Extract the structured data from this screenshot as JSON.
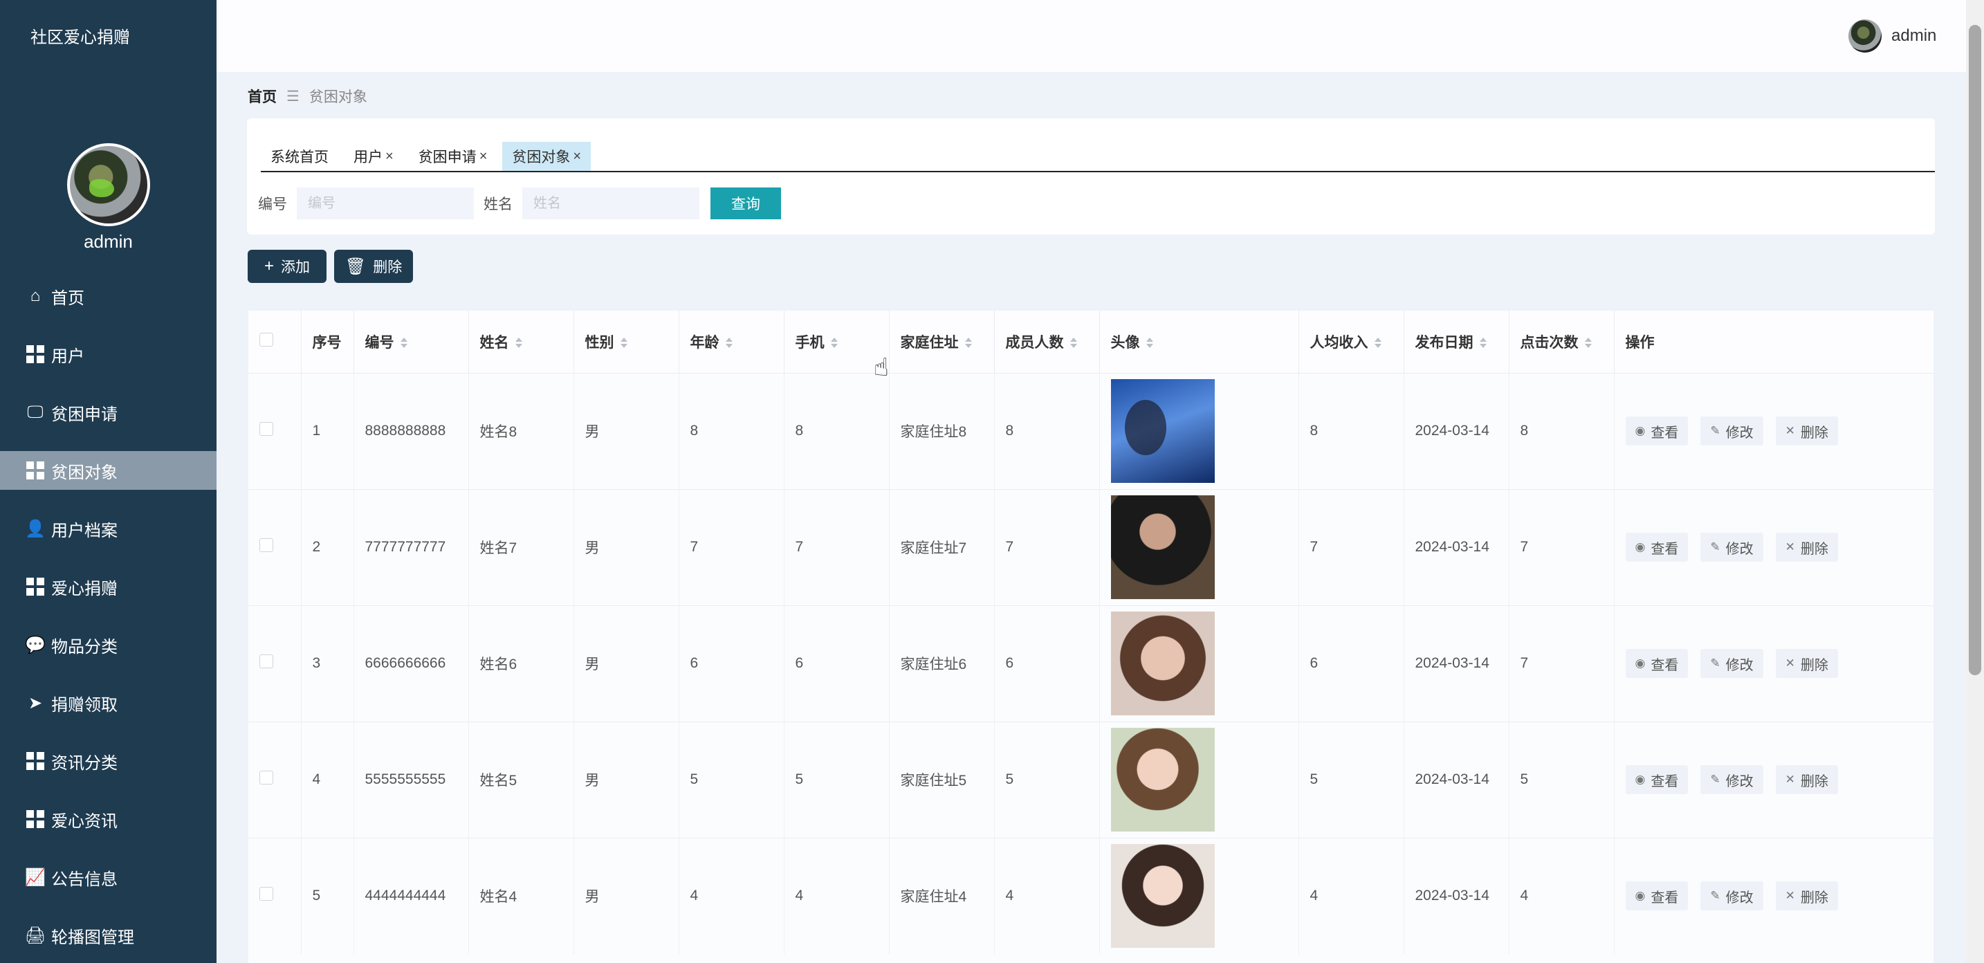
{
  "sidebar": {
    "app_title": "社区爱心捐赠",
    "username": "admin",
    "items": [
      {
        "label": "首页",
        "icon": "home-icon"
      },
      {
        "label": "用户",
        "icon": "grid-icon"
      },
      {
        "label": "贫困申请",
        "icon": "monitor-icon"
      },
      {
        "label": "贫困对象",
        "icon": "grid-icon",
        "active": true
      },
      {
        "label": "用户档案",
        "icon": "user-icon"
      },
      {
        "label": "爱心捐赠",
        "icon": "grid-icon"
      },
      {
        "label": "物品分类",
        "icon": "comment-icon"
      },
      {
        "label": "捐赠领取",
        "icon": "send-icon"
      },
      {
        "label": "资讯分类",
        "icon": "grid-icon"
      },
      {
        "label": "爱心资讯",
        "icon": "grid-icon"
      },
      {
        "label": "公告信息",
        "icon": "chart-icon"
      },
      {
        "label": "轮播图管理",
        "icon": "printer-icon"
      }
    ]
  },
  "topbar": {
    "username": "admin"
  },
  "breadcrumb": {
    "home": "首页",
    "separator": "☰",
    "current": "贫困对象"
  },
  "tabs": [
    {
      "label": "系统首页",
      "closable": false
    },
    {
      "label": "用户",
      "closable": true
    },
    {
      "label": "贫困申请",
      "closable": true
    },
    {
      "label": "贫困对象",
      "closable": true,
      "active": true
    }
  ],
  "tab_close_glyph": "×",
  "search": {
    "field1_label": "编号",
    "field1_placeholder": "编号",
    "field2_label": "姓名",
    "field2_placeholder": "姓名",
    "query_label": "查询",
    "query_color": "#19a2ad"
  },
  "actions": {
    "add_label": "添加",
    "delete_label": "删除"
  },
  "table": {
    "headers": [
      "序号",
      "编号",
      "姓名",
      "性别",
      "年龄",
      "手机",
      "家庭住址",
      "成员人数",
      "头像",
      "人均收入",
      "发布日期",
      "点击次数",
      "操作"
    ],
    "sortable": [
      false,
      true,
      true,
      true,
      true,
      true,
      true,
      true,
      true,
      true,
      true,
      true,
      false
    ],
    "rows": [
      {
        "index": "1",
        "code": "8888888888",
        "name": "姓名8",
        "gender": "男",
        "age": "8",
        "phone": "8",
        "address": "家庭住址8",
        "members": "8",
        "income": "8",
        "date": "2024-03-14",
        "clicks": "8"
      },
      {
        "index": "2",
        "code": "7777777777",
        "name": "姓名7",
        "gender": "男",
        "age": "7",
        "phone": "7",
        "address": "家庭住址7",
        "members": "7",
        "income": "7",
        "date": "2024-03-14",
        "clicks": "7"
      },
      {
        "index": "3",
        "code": "6666666666",
        "name": "姓名6",
        "gender": "男",
        "age": "6",
        "phone": "6",
        "address": "家庭住址6",
        "members": "6",
        "income": "6",
        "date": "2024-03-14",
        "clicks": "7"
      },
      {
        "index": "4",
        "code": "5555555555",
        "name": "姓名5",
        "gender": "男",
        "age": "5",
        "phone": "5",
        "address": "家庭住址5",
        "members": "5",
        "income": "5",
        "date": "2024-03-14",
        "clicks": "5"
      },
      {
        "index": "5",
        "code": "4444444444",
        "name": "姓名4",
        "gender": "男",
        "age": "4",
        "phone": "4",
        "address": "家庭住址4",
        "members": "4",
        "income": "4",
        "date": "2024-03-14",
        "clicks": "4"
      }
    ],
    "row_actions": {
      "view": "查看",
      "edit": "修改",
      "delete": "删除"
    }
  },
  "colors": {
    "sidebar_bg": "#1f3b50",
    "active_menu": "#8b9aa8",
    "accent": "#19a2ad",
    "active_tab": "#cde9f7"
  }
}
